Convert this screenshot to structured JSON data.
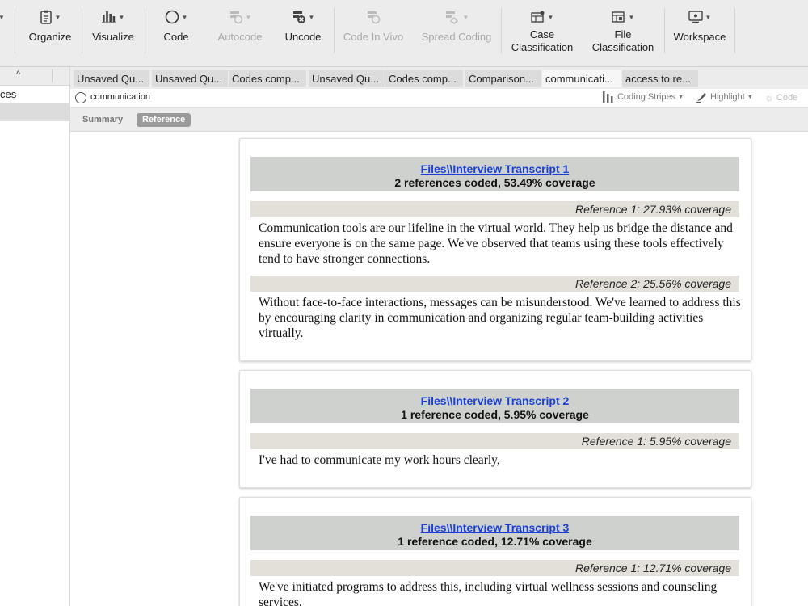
{
  "toolbar": {
    "items": [
      {
        "label": "Organize",
        "icon": "clipboard-icon",
        "enabled": true
      },
      {
        "label": "Visualize",
        "icon": "bar-chart-icon",
        "enabled": true
      },
      {
        "label": "Code",
        "icon": "circle-icon",
        "enabled": true
      },
      {
        "label": "Autocode",
        "icon": "autocode-icon",
        "enabled": false
      },
      {
        "label": "Uncode",
        "icon": "uncode-icon",
        "enabled": true
      },
      {
        "label": "Code In Vivo",
        "icon": "code-in-vivo-icon",
        "enabled": false
      },
      {
        "label": "Spread Coding",
        "icon": "spread-coding-icon",
        "enabled": false
      },
      {
        "label": "Case\nClassification",
        "icon": "case-classification-icon",
        "enabled": true
      },
      {
        "label": "File\nClassification",
        "icon": "file-classification-icon",
        "enabled": true
      },
      {
        "label": "Workspace",
        "icon": "workspace-icon",
        "enabled": true
      }
    ]
  },
  "left_pane": {
    "sort_icon": "caret-up-icon",
    "rows": [
      {
        "label": "ces",
        "selected": false
      },
      {
        "label": "",
        "selected": true
      }
    ]
  },
  "tabs": [
    {
      "label": "Unsaved Qu...",
      "active": false
    },
    {
      "label": "Unsaved Qu...",
      "active": false
    },
    {
      "label": "Codes comp...",
      "active": false
    },
    {
      "label": "Unsaved Qu...",
      "active": false
    },
    {
      "label": "Codes comp...",
      "active": false
    },
    {
      "label": "Comparison...",
      "active": false
    },
    {
      "label": "communicati...",
      "active": true
    },
    {
      "label": "access to re...",
      "active": false
    }
  ],
  "node": {
    "name": "communication",
    "coding_stripes": "Coding Stripes",
    "highlight": "Highlight",
    "code": "Code"
  },
  "view": {
    "summary": "Summary",
    "reference": "Reference",
    "active": "Reference"
  },
  "files": [
    {
      "link": "Files\\\\Interview Transcript 1",
      "coverage": "2 references coded, 53.49% coverage",
      "references": [
        {
          "label": "Reference 1: 27.93% coverage",
          "text": "Communication tools are our lifeline in the virtual world. They help us bridge the distance and ensure everyone is on the same page. We've observed that teams using these tools effectively tend to have stronger connections."
        },
        {
          "label": "Reference 2: 25.56% coverage",
          "text": "Without face-to-face interactions, messages can be misunderstood. We've learned to address this by encouraging clarity in communication and organizing regular team-building activities virtually."
        }
      ]
    },
    {
      "link": "Files\\\\Interview Transcript 2",
      "coverage": "1 reference coded, 5.95% coverage",
      "references": [
        {
          "label": "Reference 1: 5.95% coverage",
          "text": "I've had to communicate my work hours clearly,"
        }
      ]
    },
    {
      "link": "Files\\\\Interview Transcript 3",
      "coverage": "1 reference coded, 12.71% coverage",
      "references": [
        {
          "label": "Reference 1: 12.71% coverage",
          "text": "We've initiated programs to address this, including virtual wellness sessions and counseling services."
        }
      ]
    }
  ]
}
